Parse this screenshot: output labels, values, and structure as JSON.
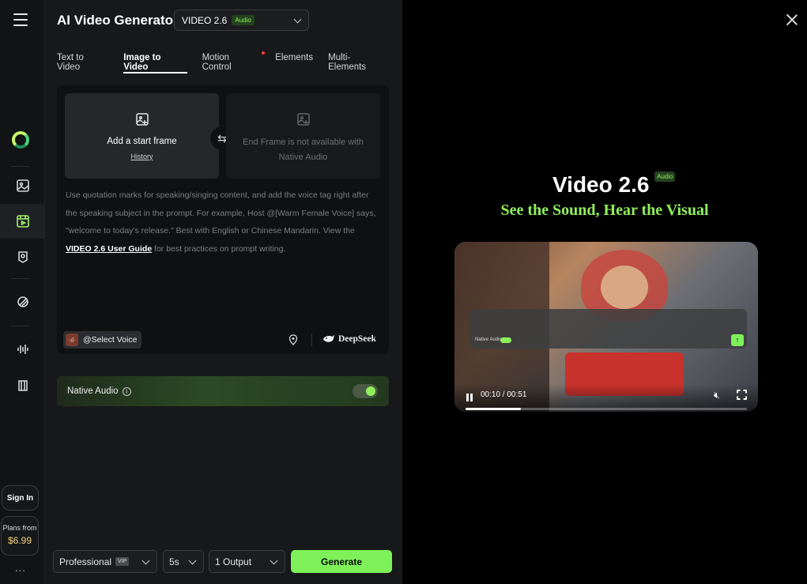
{
  "rail": {
    "signin": "Sign In",
    "plans_line1": "Plans from",
    "plans_price": "$6.99",
    "more": "..."
  },
  "panel": {
    "title": "AI Video Generator",
    "model": "VIDEO 2.6",
    "model_badge": "Audio",
    "tabs": [
      {
        "label": "Text to Video"
      },
      {
        "label": "Image to Video"
      },
      {
        "label": "Motion Control"
      },
      {
        "label": "Elements"
      },
      {
        "label": "Multi-Elements"
      }
    ],
    "start_frame": {
      "label": "Add a start frame",
      "history": "History"
    },
    "end_frame": {
      "label": "End Frame is not available with Native Audio"
    },
    "hint": {
      "text1": "Use quotation marks for speaking/singing content, and add the voice tag right after the speaking subject in the prompt. For example, Host @[Warm Female Voice] says, \"welcome to today's release.\" Best with English or Chinese Mandarin. View the ",
      "link": "VIDEO 2.6 User Guide",
      "text2": " for best practices on prompt writing."
    },
    "select_voice": "@Select Voice",
    "deepseek": "DeepSeek",
    "native_audio": "Native Audio",
    "native_audio_on": true
  },
  "bottom": {
    "mode": "Professional",
    "mode_badge": "VIP",
    "duration": "5s",
    "outputs": "1 Output",
    "generate": "Generate"
  },
  "preview": {
    "title": "Video 2.6",
    "badge": "Audio",
    "subtitle": "See the Sound, Hear the Visual",
    "overlay_label": "Native Audio",
    "time": "00:10 / 00:51",
    "progress": 0.196
  },
  "colors": {
    "accent": "#7ef05a",
    "panel_bg": "#161819",
    "rail_bg": "#111315"
  }
}
